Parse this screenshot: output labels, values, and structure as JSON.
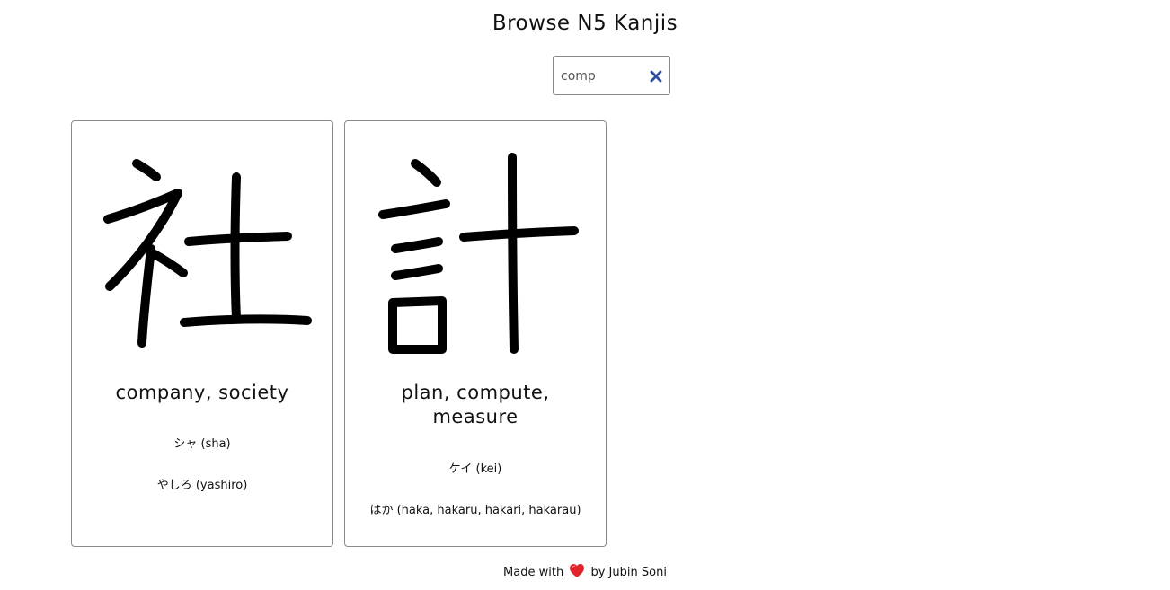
{
  "header": {
    "title": "Browse N5 Kanjis"
  },
  "search": {
    "value": "comp",
    "clear_icon": "close-icon",
    "accent_color": "#2f4ea0"
  },
  "cards": [
    {
      "kanji": "社",
      "meaning": "company, society",
      "onyomi": "シャ (sha)",
      "kunyomi": "やしろ (yashiro)"
    },
    {
      "kanji": "計",
      "meaning_line1": "plan, compute,",
      "meaning_line2": "measure",
      "onyomi": "ケイ (kei)",
      "kunyomi": "はか (haka, hakaru, hakari, hakarau)"
    }
  ],
  "footer": {
    "prefix": "Made with",
    "heart_icon": "heart-icon",
    "heart_color": "#e0242a",
    "suffix": "by Jubin Soni"
  }
}
